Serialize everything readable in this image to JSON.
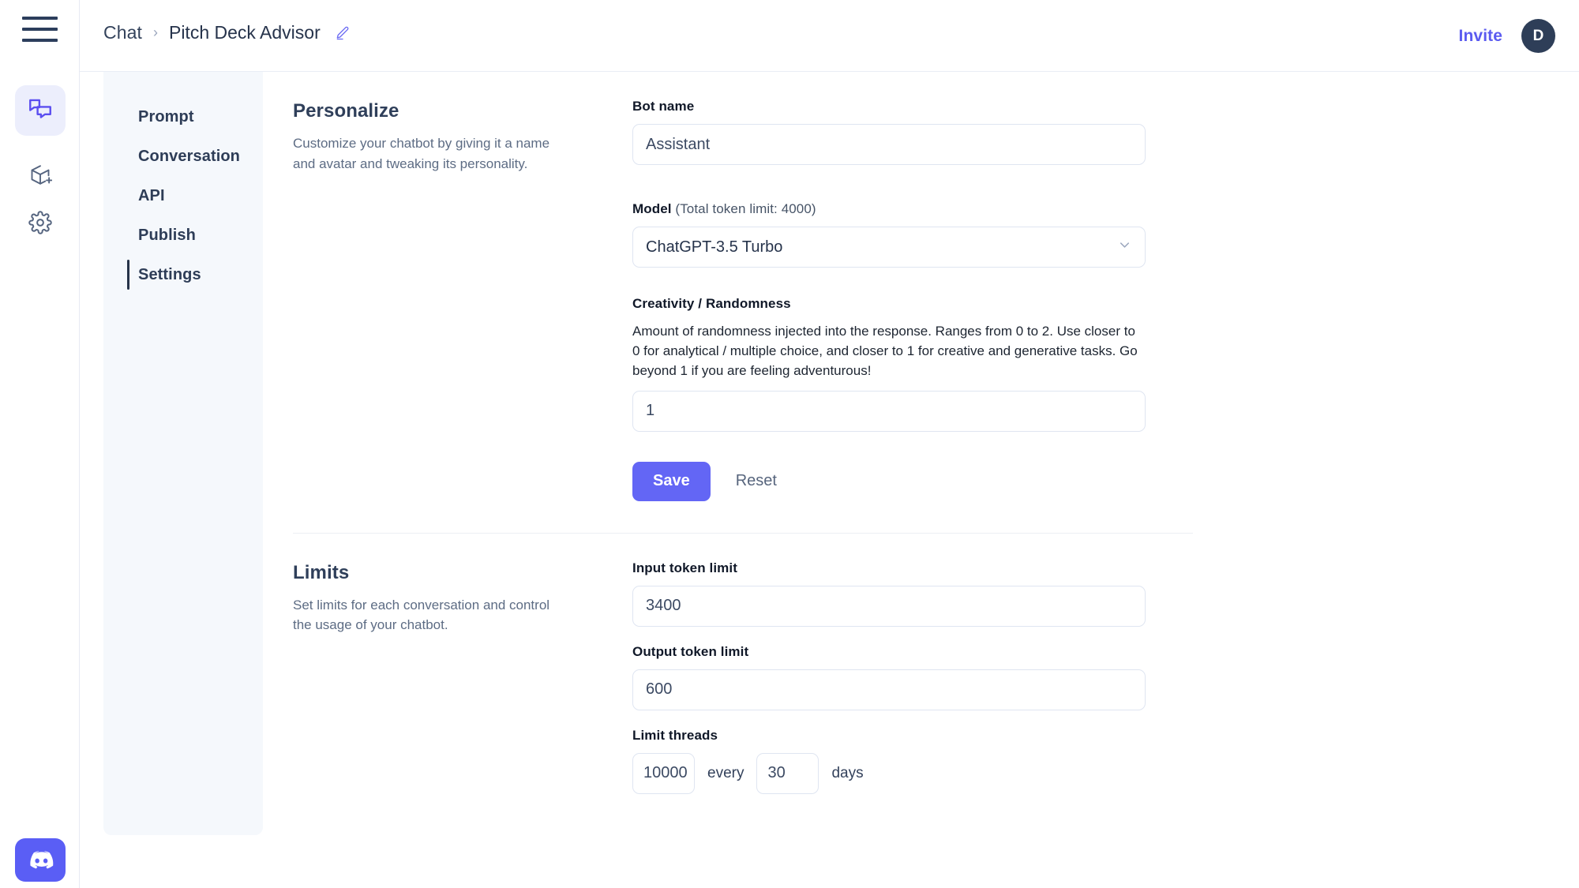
{
  "rail": {
    "menu_icon": "hamburger-menu-icon",
    "items": [
      {
        "icon": "chat-bubbles-icon",
        "name": "chat",
        "active": true
      },
      {
        "icon": "add-box-icon",
        "name": "new-bot",
        "active": false
      },
      {
        "icon": "gear-icon",
        "name": "settings",
        "active": false
      }
    ],
    "discord_icon": "discord-icon"
  },
  "topbar": {
    "breadcrumb_root": "Chat",
    "breadcrumb_separator": "›",
    "breadcrumb_current": "Pitch Deck Advisor",
    "edit_icon": "pencil-edit-icon",
    "invite_label": "Invite",
    "avatar_initial": "D"
  },
  "nav": {
    "items": [
      {
        "label": "Prompt",
        "active": false
      },
      {
        "label": "Conversation",
        "active": false
      },
      {
        "label": "API",
        "active": false
      },
      {
        "label": "Publish",
        "active": false
      },
      {
        "label": "Settings",
        "active": true
      }
    ]
  },
  "personalize": {
    "title": "Personalize",
    "description": "Customize your chatbot by giving it a name and avatar and tweaking its personality.",
    "bot_name": {
      "label": "Bot name",
      "value": "Assistant",
      "placeholder": "Bot name"
    },
    "model": {
      "label": "Model",
      "label_muted": " (Total token limit: 4000)",
      "value": "ChatGPT-3.5 Turbo",
      "chevron_icon": "chevron-down-icon"
    },
    "creativity": {
      "label": "Creativity / Randomness",
      "help": "Amount of randomness injected into the response. Ranges from 0 to 2. Use closer to 0 for analytical / multiple choice, and closer to 1 for creative and generative tasks. Go beyond 1 if you are feeling adventurous!",
      "value": "1",
      "placeholder": "1"
    },
    "save_label": "Save",
    "reset_label": "Reset"
  },
  "limits": {
    "title": "Limits",
    "description": "Set limits for each conversation and control the usage of your chatbot.",
    "input_token": {
      "label": "Input token limit",
      "value": "3400",
      "placeholder": "3400"
    },
    "output_token": {
      "label": "Output token limit",
      "value": "600",
      "placeholder": "600"
    },
    "limit_threads": {
      "label": "Limit threads",
      "count_value": "10000",
      "count_placeholder": "10000",
      "every_label": "every",
      "days_value": "30",
      "days_placeholder": "30",
      "days_label": "days"
    }
  },
  "colors": {
    "accent": "#6366f5",
    "invite": "#5b5bf0",
    "discord": "#5a5ef5",
    "nav_panel_bg": "#f5f8fc",
    "rail_active_bg": "#eceefc",
    "avatar_bg": "#2e3e58"
  }
}
